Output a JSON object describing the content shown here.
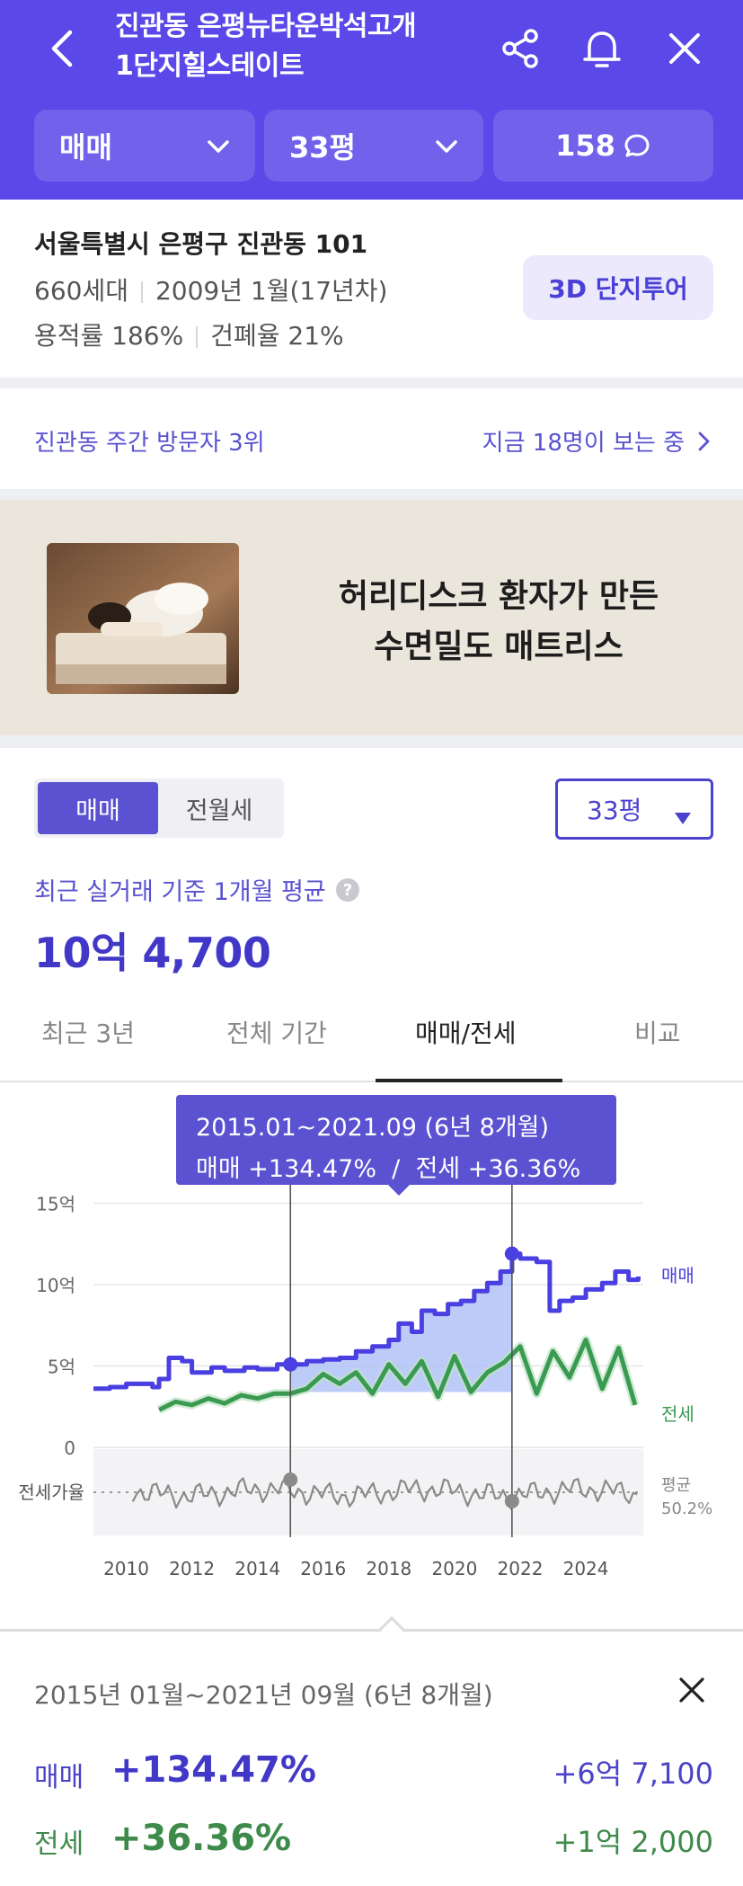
{
  "header": {
    "title_line1": "진관동 은평뉴타운박석고개",
    "title_line2": "1단지힐스테이트",
    "filters": {
      "trade_type": "매매",
      "size": "33평",
      "comment_count": "158"
    }
  },
  "complex": {
    "address": "서울특별시 은평구 진관동 101",
    "households": "660세대",
    "built": "2009년 1월(17년차)",
    "floor_area_ratio": "용적률 186%",
    "building_coverage": "건폐율 21%",
    "tour_button": "3D 단지투어"
  },
  "popularity": {
    "rank": "진관동 주간 방문자 3위",
    "viewers": "지금 18명이 보는 중"
  },
  "ad": {
    "line1": "허리디스크 환자가 만든",
    "line2": "수면밀도 매트리스"
  },
  "price": {
    "segments": [
      "매매",
      "전월세"
    ],
    "active_segment": "매매",
    "size_select": "33평",
    "basis": "최근 실거래 기준 1개월 평균",
    "value": "10억 4,700"
  },
  "tabs": [
    "최근 3년",
    "전체 기간",
    "매매/전세",
    "비교"
  ],
  "active_tab": "매매/전세",
  "tooltip": {
    "period": "2015.01~2021.09 (6년 8개월)",
    "summary": "매매 +134.47%  /  전세 +36.36%"
  },
  "chart_data": {
    "type": "line",
    "x_ticks": [
      "2010",
      "2012",
      "2014",
      "2016",
      "2018",
      "2020",
      "2022",
      "2024"
    ],
    "y_ticks": [
      "15억",
      "10억",
      "5억",
      "0"
    ],
    "series": [
      {
        "name": "매매",
        "color": "#4a3fe0",
        "x": [
          2009.0,
          2009.5,
          2010.0,
          2010.8,
          2011.0,
          2011.3,
          2011.7,
          2012.0,
          2012.6,
          2013.0,
          2013.6,
          2014.0,
          2014.6,
          2015.0,
          2015.5,
          2016.0,
          2016.5,
          2017.0,
          2017.5,
          2018.0,
          2018.3,
          2018.7,
          2019.0,
          2019.4,
          2019.8,
          2020.2,
          2020.6,
          2021.0,
          2021.4,
          2021.75,
          2022.0,
          2022.5,
          2022.9,
          2023.2,
          2023.6,
          2024.0,
          2024.5,
          2024.9,
          2025.3,
          2025.6
        ],
        "y": [
          3.6,
          3.7,
          3.9,
          3.7,
          4.2,
          5.5,
          5.3,
          4.6,
          4.9,
          4.7,
          4.9,
          4.8,
          5.1,
          5.1,
          5.3,
          5.4,
          5.5,
          5.9,
          6.2,
          6.6,
          7.6,
          7.1,
          8.4,
          8.2,
          8.8,
          9.0,
          9.6,
          10.1,
          10.8,
          11.9,
          11.6,
          11.4,
          8.4,
          9.0,
          9.2,
          9.7,
          10.1,
          10.8,
          10.3,
          10.5
        ]
      },
      {
        "name": "전세",
        "color": "#3a9a52",
        "x": [
          2011.0,
          2011.5,
          2012.0,
          2012.5,
          2013.0,
          2013.5,
          2014.0,
          2014.5,
          2015.0,
          2015.5,
          2016.0,
          2016.5,
          2017.0,
          2017.5,
          2018.0,
          2018.5,
          2019.0,
          2019.5,
          2020.0,
          2020.5,
          2021.0,
          2021.5,
          2022.0,
          2022.5,
          2023.0,
          2023.5,
          2024.0,
          2024.5,
          2025.0,
          2025.5
        ],
        "y": [
          2.3,
          2.8,
          2.6,
          3.0,
          2.7,
          3.2,
          3.0,
          3.3,
          3.3,
          3.6,
          4.5,
          3.9,
          4.6,
          3.3,
          5.1,
          3.9,
          5.3,
          3.1,
          5.6,
          3.4,
          4.6,
          5.2,
          6.2,
          3.3,
          5.9,
          4.3,
          6.6,
          3.6,
          6.1,
          2.6
        ]
      }
    ],
    "ratio_series": {
      "label": "전세가율",
      "average_label": "평균",
      "average_value": "50.2%"
    },
    "series_labels": [
      "매매",
      "전세"
    ],
    "selection": {
      "start": "2015.01",
      "end": "2021.09"
    }
  },
  "summary": {
    "period": "2015년 01월~2021년 09월 (6년 8개월)",
    "rows": [
      {
        "label": "매매",
        "change": "+134.47%",
        "amount": "+6억 7,100"
      },
      {
        "label": "전세",
        "change": "+36.36%",
        "amount": "+1억 2,000"
      }
    ]
  }
}
